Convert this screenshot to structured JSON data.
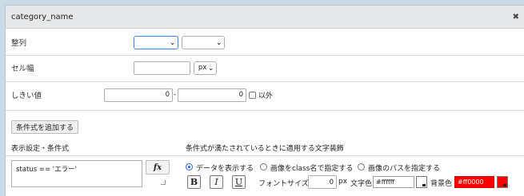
{
  "dialog": {
    "title": "category_name",
    "close_icon": "close-icon"
  },
  "sort": {
    "label": "整列",
    "select1_value": "",
    "select2_value": ""
  },
  "cell_width": {
    "label": "セル幅",
    "input_value": "",
    "unit": "px"
  },
  "threshold": {
    "label": "しきい値",
    "from_value": "0",
    "dash": "-",
    "to_value": "0",
    "except_label": "以外"
  },
  "add_condition_button": "条件式を追加する",
  "columns": {
    "left_header": "表示設定・条件式",
    "right_header": "条件式が満たされているときに適用する文字装飾"
  },
  "condition": {
    "expression": "status == 'エラー'",
    "fx_label": "fx",
    "radio_options": [
      "データを表示する",
      "画像をclass名で指定する",
      "画像のパスを指定する"
    ],
    "selected_radio": 0,
    "bold_label": "B",
    "italic_label": "I",
    "underline_label": "U",
    "font_size_label": "フォントサイズ",
    "font_size_value": "0",
    "font_size_unit": "px",
    "text_color_label": "文字色",
    "text_color_value": "#ffffff",
    "bg_color_label": "背景色",
    "bg_color_value": "#ff0000"
  },
  "colors": {
    "bg_swatch": "#ff0000",
    "text_swatch": "#ffffff",
    "selected_border": "#3b82f6"
  }
}
